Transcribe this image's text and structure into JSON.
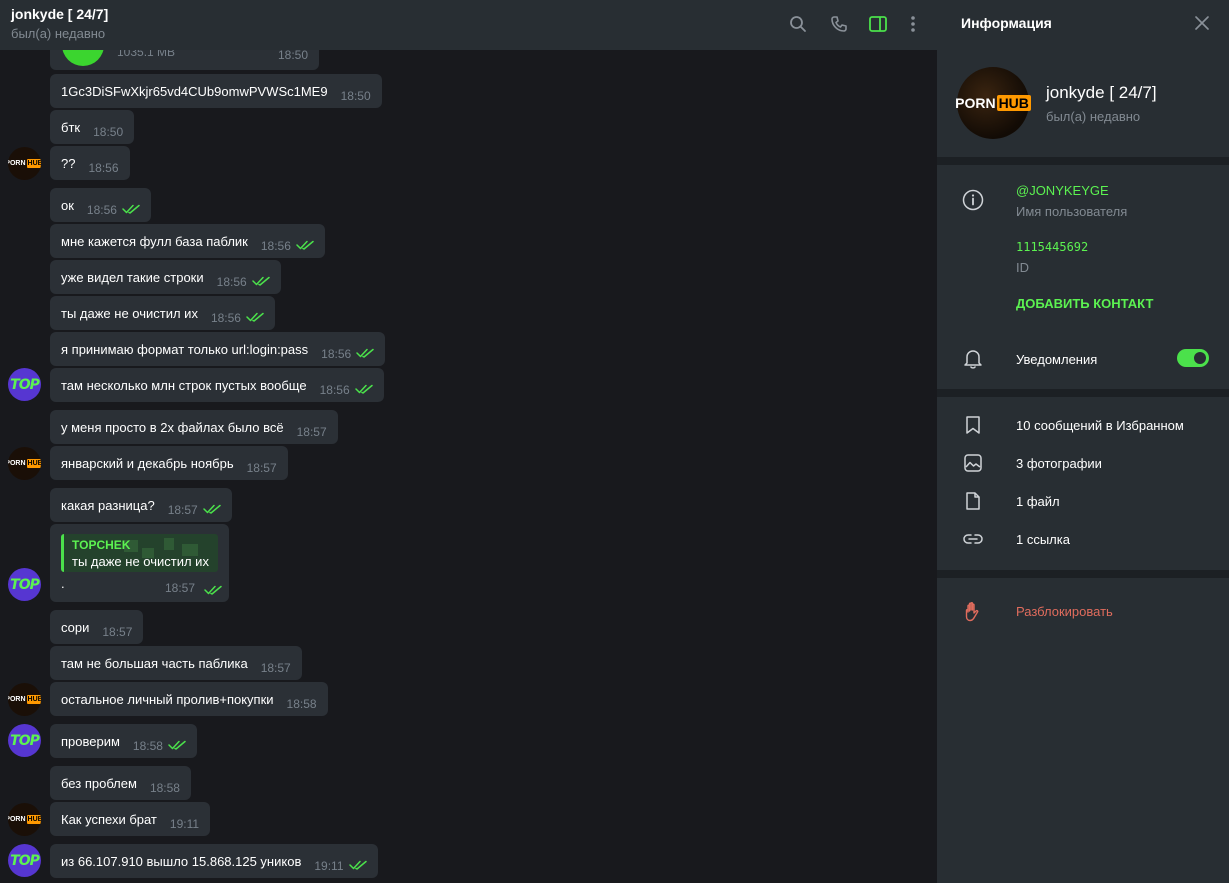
{
  "header": {
    "title": "jonkyde [ 24/7]",
    "status": "был(а) недавно",
    "accent": "#5cf251"
  },
  "file": {
    "size": "1035.1 MB",
    "time": "18:50"
  },
  "messages": [
    {
      "text": "1Gc3DiSFwXkjr65vd4CUb9omwPVWSc1ME9",
      "time": "18:50",
      "sent": false
    },
    {
      "text": "бтк",
      "time": "18:50",
      "sent": false
    },
    {
      "text": "??",
      "time": "18:56",
      "sent": false
    },
    {
      "text": "ок",
      "time": "18:56",
      "sent": true
    },
    {
      "text": "мне кажется фулл база паблик",
      "time": "18:56",
      "sent": true
    },
    {
      "text": "уже видел такие строки",
      "time": "18:56",
      "sent": true
    },
    {
      "text": "ты даже не очистил их",
      "time": "18:56",
      "sent": true
    },
    {
      "text": "я принимаю формат только url:login:pass",
      "time": "18:56",
      "sent": true
    },
    {
      "text": "там несколько млн строк пустых вообще",
      "time": "18:56",
      "sent": true
    },
    {
      "text": "у меня просто в 2х файлах было всё",
      "time": "18:57",
      "sent": false
    },
    {
      "text": "январский и декабрь ноябрь",
      "time": "18:57",
      "sent": false
    },
    {
      "text": "какая разница?",
      "time": "18:57",
      "sent": true
    },
    {
      "text": "сори",
      "time": "18:57",
      "sent": false
    },
    {
      "text": "там не большая часть паблика",
      "time": "18:57",
      "sent": false
    },
    {
      "text": "остальное личный пролив+покупки",
      "time": "18:58",
      "sent": false
    },
    {
      "text": "проверим",
      "time": "18:58",
      "sent": true
    },
    {
      "text": "без проблем",
      "time": "18:58",
      "sent": false
    },
    {
      "text": "Как успехи брат",
      "time": "19:11",
      "sent": false
    },
    {
      "text": "из 66.107.910 вышло 15.868.125 уников",
      "time": "19:11",
      "sent": true
    }
  ],
  "reply": {
    "author": "TOPCHEK",
    "quote": "ты даже не очистил их",
    "text": ".",
    "time": "18:57"
  },
  "avatars": {
    "porn_text": "PORN",
    "hub_text": "HUB",
    "top_text": "TOP"
  },
  "info": {
    "title": "Информация",
    "name": "jonkyde [ 24/7]",
    "status": "был(а) недавно",
    "username": "@JONYKEYGE",
    "username_label": "Имя пользователя",
    "id": "1115445692",
    "id_label": "ID",
    "add_contact": "ДОБАВИТЬ КОНТАКТ",
    "notifications": "Уведомления",
    "notifications_on": true,
    "saved": "10 сообщений в Избранном",
    "photos": "3 фотографии",
    "files": "1 файл",
    "links": "1 ссылка",
    "unblock": "Разблокировать"
  }
}
